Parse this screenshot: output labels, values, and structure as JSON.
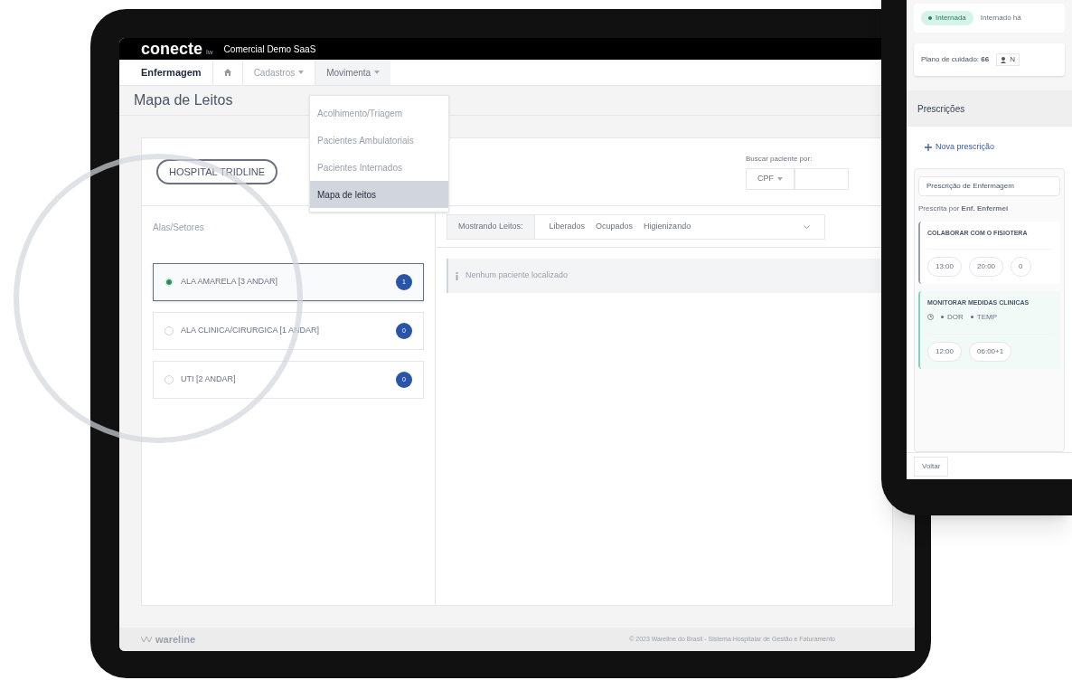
{
  "main_tablet": {
    "header": {
      "logo": "conecte",
      "logo_suffix": "lw",
      "company": "Comercial Demo SaaS"
    },
    "nav": [
      {
        "label": "Enfermagem",
        "kind": "module"
      },
      {
        "kind": "home"
      },
      {
        "label": "Cadastros",
        "kind": "dropdown",
        "expanded": false
      },
      {
        "label": "Movimenta",
        "kind": "dropdown",
        "expanded": true
      }
    ],
    "menu": [
      {
        "label": "Acolhimento/Triagem",
        "selected": false
      },
      {
        "label": "Pacientes Ambulatoriais",
        "selected": false
      },
      {
        "label": "Pacientes Internados",
        "selected": false
      },
      {
        "label": "Mapa de leitos",
        "selected": true
      }
    ],
    "page_title": "Mapa de Leitos",
    "hospital": "HOSPITAL TRIDLINE",
    "search": {
      "label": "Buscar paciente por:",
      "type": "CPF"
    },
    "sectors_title": "Alas/Setores",
    "sectors": [
      {
        "name": "ALA AMARELA [3 ANDAR]",
        "count": "1",
        "selected": true
      },
      {
        "name": "ALA CLINICA/CIRURGICA [1 ANDAR]",
        "count": "0",
        "selected": false
      },
      {
        "name": "UTI [2 ANDAR]",
        "count": "0",
        "selected": false
      }
    ],
    "filter": {
      "label": "Mostrando Leitos:",
      "options": [
        "Liberados",
        "Ocupados",
        "Higienizando"
      ]
    },
    "message": "Nenhum paciente localizado",
    "footer": {
      "logo": "wareline",
      "copyright": "© 2023 Wareline do Brasil - Sistema Hospitalar de Gestão e Faturamento"
    }
  },
  "side_tablet": {
    "tags": [
      {
        "label": "Internada",
        "kind": "status"
      },
      {
        "label": "Internado há",
        "kind": "plain"
      }
    ],
    "care_plan": {
      "label": "Plano de cuidado:",
      "value": "66",
      "next": "N"
    },
    "section_title": "Prescrições",
    "new_button": "Nova prescrição",
    "prescription": {
      "title": "Prescrição de Enfermagem",
      "by": "Prescrita por **Enf. Enfermei**"
    },
    "items": [
      {
        "title": "COLABORAR COM O FISIOTERA",
        "times": [
          "13:00",
          "20:00",
          "0"
        ],
        "active": false
      },
      {
        "title": "MONITORAR MEDIDAS CLINICAS",
        "tags": [
          "DOR",
          "TEMP"
        ],
        "times": [
          "12:00",
          "06:00+1"
        ],
        "active": true
      }
    ],
    "back_button": "Voltar"
  }
}
